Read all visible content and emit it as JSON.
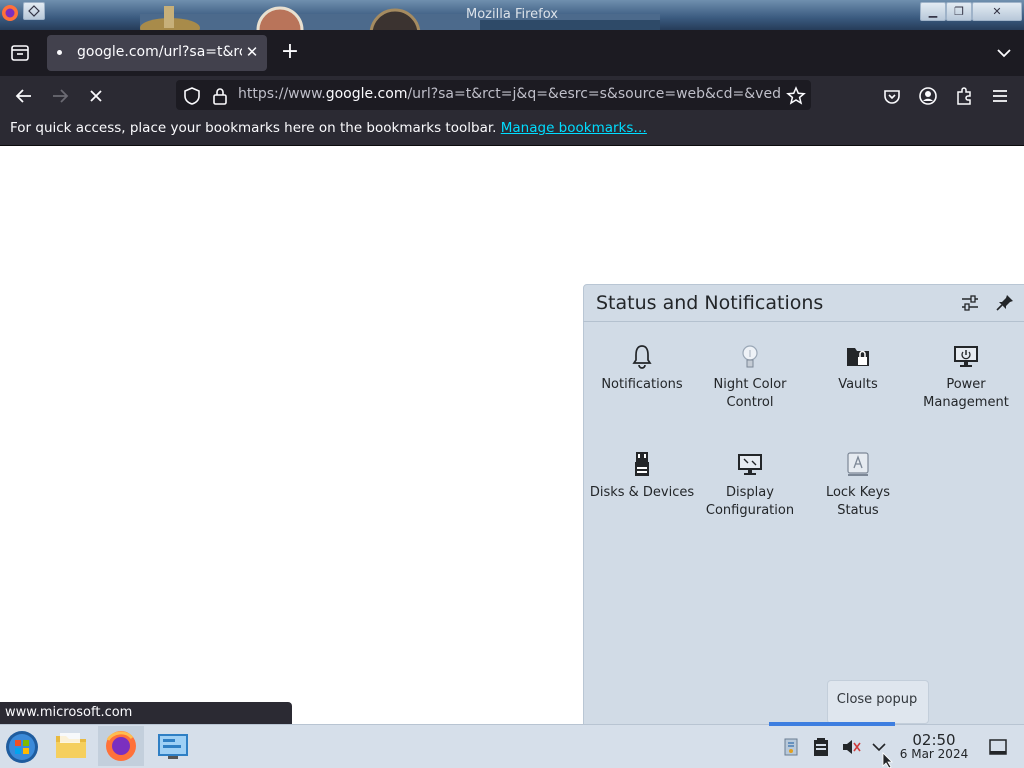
{
  "window": {
    "title": "Mozilla Firefox"
  },
  "tab": {
    "title": "google.com/url?sa=t&rct"
  },
  "urlbar": {
    "prefix": "https://www.",
    "domain": "google.com",
    "rest": "/url?sa=t&rct=j&q=&esrc=s&source=web&cd=&ved"
  },
  "bookmarks": {
    "text": "For quick access, place your bookmarks here on the bookmarks toolbar.",
    "link": "Manage bookmarks…"
  },
  "panel": {
    "title": "Status and Notifications",
    "items": [
      {
        "label": "Notifications",
        "icon": "bell-icon"
      },
      {
        "label": "Night Color Control",
        "icon": "lightbulb-icon"
      },
      {
        "label": "Vaults",
        "icon": "vault-lock-icon"
      },
      {
        "label": "Power Management",
        "icon": "monitor-power-icon"
      },
      {
        "label": "Disks & Devices",
        "icon": "usb-drive-icon"
      },
      {
        "label": "Display Configuration",
        "icon": "display-icon"
      },
      {
        "label": "Lock Keys Status",
        "icon": "lock-key-icon"
      }
    ]
  },
  "tooltip": {
    "text": "Close popup"
  },
  "statusbar": {
    "url": "www.microsoft.com"
  },
  "clock": {
    "time": "02:50",
    "date": "6 Mar 2024"
  },
  "colors": {
    "accent": "#3d7ee0",
    "link": "#00ddff",
    "panel_bg": "#d1dbe6",
    "toolbar": "#2b2a33"
  }
}
